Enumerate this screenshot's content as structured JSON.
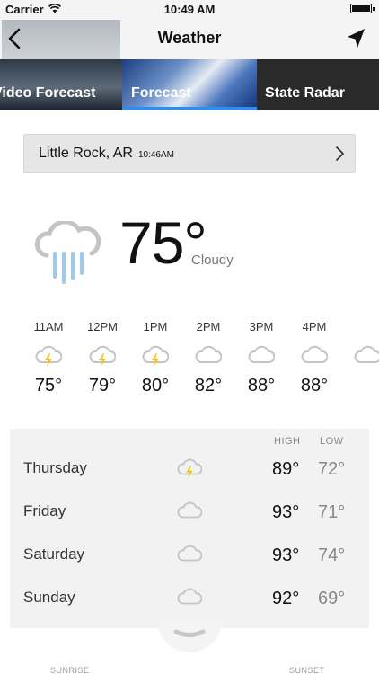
{
  "status": {
    "carrier": "Carrier",
    "time": "10:49 AM"
  },
  "nav": {
    "title": "Weather"
  },
  "tabs": [
    {
      "label": "Video Forecast"
    },
    {
      "label": "Forecast"
    },
    {
      "label": "State Radar"
    }
  ],
  "location": {
    "city": "Little Rock, AR",
    "time": "10:46AM"
  },
  "current": {
    "temp": "75°",
    "condition": "Cloudy"
  },
  "hourly": [
    {
      "time": "11AM",
      "icon": "thunder-cloud-icon",
      "temp": "75°"
    },
    {
      "time": "12PM",
      "icon": "thunder-cloud-icon",
      "temp": "79°"
    },
    {
      "time": "1PM",
      "icon": "thunder-cloud-icon",
      "temp": "80°"
    },
    {
      "time": "2PM",
      "icon": "cloud-icon",
      "temp": "82°"
    },
    {
      "time": "3PM",
      "icon": "cloud-icon",
      "temp": "88°"
    },
    {
      "time": "4PM",
      "icon": "cloud-icon",
      "temp": "88°"
    }
  ],
  "daily": {
    "high_label": "HIGH",
    "low_label": "LOW",
    "days": [
      {
        "name": "Thursday",
        "icon": "thunder-cloud-icon",
        "high": "89°",
        "low": "72°"
      },
      {
        "name": "Friday",
        "icon": "cloud-icon",
        "high": "93°",
        "low": "71°"
      },
      {
        "name": "Saturday",
        "icon": "cloud-icon",
        "high": "93°",
        "low": "74°"
      },
      {
        "name": "Sunday",
        "icon": "cloud-icon",
        "high": "92°",
        "low": "69°"
      }
    ]
  },
  "sun": {
    "sunrise_label": "SUNRISE",
    "sunset_label": "SUNSET"
  },
  "colors": {
    "accent": "#2a8ff0",
    "rain": "#9ccbec",
    "bolt": "#f2c318",
    "cloud": "#c4c4c4"
  }
}
